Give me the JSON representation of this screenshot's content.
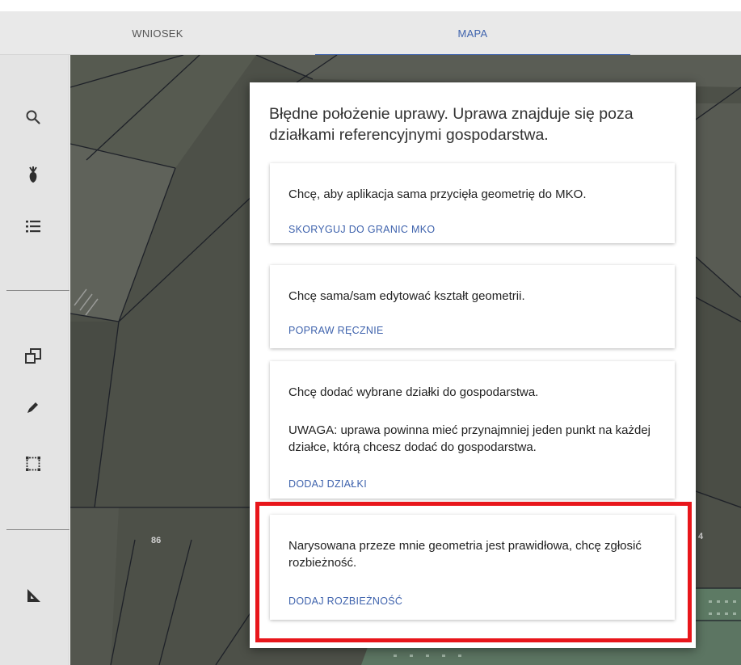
{
  "tabs": [
    {
      "label": "WNIOSEK"
    },
    {
      "label": "MAPA"
    }
  ],
  "sidebar": {
    "icons": [
      "search-icon",
      "plant-icon",
      "list-icon",
      "copy-layers-icon",
      "pencil-icon",
      "selection-rectangle-icon",
      "ruler-triangle-icon"
    ]
  },
  "map": {
    "parcel_labels": [
      "86",
      "4"
    ]
  },
  "dialog": {
    "title": "Błędne położenie uprawy. Uprawa znajduje się poza działkami referencyjnymi gospodarstwa.",
    "options": [
      {
        "text": "Chcę, aby aplikacja sama przycięła geometrię do MKO.",
        "action": "SKORYGUJ DO GRANIC MKO"
      },
      {
        "text": "Chcę sama/sam edytować kształt geometrii.",
        "action": "POPRAW RĘCZNIE"
      },
      {
        "text": "Chcę dodać wybrane działki do gospodarstwa.",
        "note": "UWAGA: uprawa powinna mieć przynajmniej jeden punkt na każdej działce, którą chcesz dodać do gospodarstwa.",
        "action": "DODAJ DZIAŁKI"
      },
      {
        "text": "Narysowana przeze mnie geometria jest prawidłowa, chcę zgłosić rozbieżność.",
        "action": "DODAJ ROZBIEŻNOŚĆ"
      }
    ]
  },
  "colors": {
    "accent": "#3f63ad",
    "highlight": "#e8161b",
    "sidebar_bg": "#e4e4e4",
    "map_bg": "#4f524a"
  }
}
